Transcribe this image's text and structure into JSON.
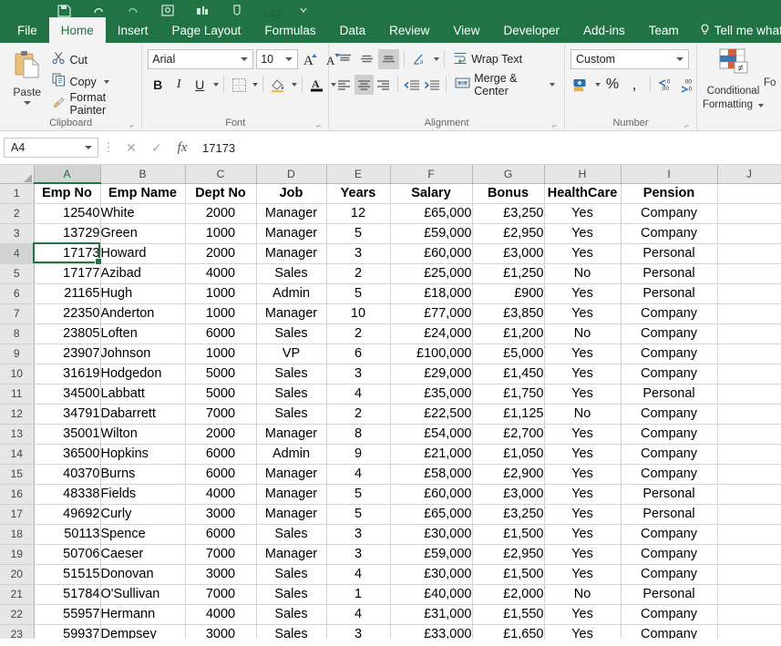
{
  "app": {
    "accent_green": "#217346",
    "ribbon_bg": "#f3f3f3"
  },
  "quick_access": {
    "icons": [
      "save-icon",
      "undo-icon",
      "redo-icon",
      "print-preview-icon",
      "chart-icon",
      "touch-mode-icon",
      "l12-icon",
      "customize-caret-icon"
    ],
    "l12_label": "L12"
  },
  "ribbon_tabs": [
    {
      "label": "File",
      "active": false
    },
    {
      "label": "Home",
      "active": true
    },
    {
      "label": "Insert",
      "active": false
    },
    {
      "label": "Page Layout",
      "active": false
    },
    {
      "label": "Formulas",
      "active": false
    },
    {
      "label": "Data",
      "active": false
    },
    {
      "label": "Review",
      "active": false
    },
    {
      "label": "View",
      "active": false
    },
    {
      "label": "Developer",
      "active": false
    },
    {
      "label": "Add-ins",
      "active": false
    },
    {
      "label": "Team",
      "active": false
    }
  ],
  "tell_me": {
    "label": "Tell me what you",
    "icon": "lightbulb-icon"
  },
  "clipboard": {
    "group_label": "Clipboard",
    "paste_label": "Paste",
    "cut_label": "Cut",
    "copy_label": "Copy",
    "format_painter_label": "Format Painter"
  },
  "font": {
    "group_label": "Font",
    "font_name": "Arial",
    "font_size": "10",
    "bold_label": "B",
    "italic_label": "I",
    "underline_label": "U",
    "grow_label": "A",
    "shrink_label": "A"
  },
  "alignment": {
    "group_label": "Alignment",
    "wrap_text_label": "Wrap Text",
    "merge_center_label": "Merge & Center"
  },
  "number": {
    "group_label": "Number",
    "format": "Custom",
    "percent_label": "%",
    "comma_label": ",",
    "increase_decimal_label": ".00",
    "decrease_decimal_label": ".00"
  },
  "styles": {
    "conditional_formatting_label": "Conditional\nFormatting",
    "conditional_formatting_line1": "Conditional",
    "conditional_formatting_line2": "Formatting",
    "format_as_table_stub_line1": "Fo",
    "format_as_table_stub_line2": ""
  },
  "formula_bar": {
    "name_box": "A4",
    "cancel_icon": "cancel-icon",
    "enter_icon": "check-icon",
    "function_icon": "fx-icon",
    "value": "17173"
  },
  "grid": {
    "column_headers": [
      "A",
      "B",
      "C",
      "D",
      "E",
      "F",
      "G",
      "H",
      "I",
      "J"
    ],
    "selected_column": "A",
    "selected_row": 4,
    "active_cell": "A4",
    "row_numbers": [
      1,
      2,
      3,
      4,
      5,
      6,
      7,
      8,
      9,
      10,
      11,
      12,
      13,
      14,
      15,
      16,
      17,
      18,
      19,
      20,
      21,
      22,
      23
    ],
    "headers": [
      "Emp No",
      "Emp Name",
      "Dept No",
      "Job",
      "Years",
      "Salary",
      "Bonus",
      "HealthCare",
      "Pension",
      ""
    ],
    "rows": [
      [
        "12540",
        "White",
        "2000",
        "Manager",
        "12",
        "£65,000",
        "£3,250",
        "Yes",
        "Company",
        ""
      ],
      [
        "13729",
        "Green",
        "1000",
        "Manager",
        "5",
        "£59,000",
        "£2,950",
        "Yes",
        "Company",
        ""
      ],
      [
        "17173",
        "Howard",
        "2000",
        "Manager",
        "3",
        "£60,000",
        "£3,000",
        "Yes",
        "Personal",
        ""
      ],
      [
        "17177",
        "Azibad",
        "4000",
        "Sales",
        "2",
        "£25,000",
        "£1,250",
        "No",
        "Personal",
        ""
      ],
      [
        "21165",
        "Hugh",
        "1000",
        "Admin",
        "5",
        "£18,000",
        "£900",
        "Yes",
        "Personal",
        ""
      ],
      [
        "22350",
        "Anderton",
        "1000",
        "Manager",
        "10",
        "£77,000",
        "£3,850",
        "Yes",
        "Company",
        ""
      ],
      [
        "23805",
        "Loften",
        "6000",
        "Sales",
        "2",
        "£24,000",
        "£1,200",
        "No",
        "Company",
        ""
      ],
      [
        "23907",
        "Johnson",
        "1000",
        "VP",
        "6",
        "£100,000",
        "£5,000",
        "Yes",
        "Company",
        ""
      ],
      [
        "31619",
        "Hodgedon",
        "5000",
        "Sales",
        "3",
        "£29,000",
        "£1,450",
        "Yes",
        "Company",
        ""
      ],
      [
        "34500",
        "Labbatt",
        "5000",
        "Sales",
        "4",
        "£35,000",
        "£1,750",
        "Yes",
        "Personal",
        ""
      ],
      [
        "34791",
        "Dabarrett",
        "7000",
        "Sales",
        "2",
        "£22,500",
        "£1,125",
        "No",
        "Company",
        ""
      ],
      [
        "35001",
        "Wilton",
        "2000",
        "Manager",
        "8",
        "£54,000",
        "£2,700",
        "Yes",
        "Company",
        ""
      ],
      [
        "36500",
        "Hopkins",
        "6000",
        "Admin",
        "9",
        "£21,000",
        "£1,050",
        "Yes",
        "Company",
        ""
      ],
      [
        "40370",
        "Burns",
        "6000",
        "Manager",
        "4",
        "£58,000",
        "£2,900",
        "Yes",
        "Company",
        ""
      ],
      [
        "48338",
        "Fields",
        "4000",
        "Manager",
        "5",
        "£60,000",
        "£3,000",
        "Yes",
        "Personal",
        ""
      ],
      [
        "49692",
        "Curly",
        "3000",
        "Manager",
        "5",
        "£65,000",
        "£3,250",
        "Yes",
        "Personal",
        ""
      ],
      [
        "50113",
        "Spence",
        "6000",
        "Sales",
        "3",
        "£30,000",
        "£1,500",
        "Yes",
        "Company",
        ""
      ],
      [
        "50706",
        "Caeser",
        "7000",
        "Manager",
        "3",
        "£59,000",
        "£2,950",
        "Yes",
        "Company",
        ""
      ],
      [
        "51515",
        "Donovan",
        "3000",
        "Sales",
        "4",
        "£30,000",
        "£1,500",
        "Yes",
        "Company",
        ""
      ],
      [
        "51784",
        "O'Sullivan",
        "7000",
        "Sales",
        "1",
        "£40,000",
        "£2,000",
        "No",
        "Personal",
        ""
      ],
      [
        "55957",
        "Hermann",
        "4000",
        "Sales",
        "4",
        "£31,000",
        "£1,550",
        "Yes",
        "Company",
        ""
      ],
      [
        "59937",
        "Dempsey",
        "3000",
        "Sales",
        "3",
        "£33,000",
        "£1,650",
        "Yes",
        "Company",
        ""
      ]
    ]
  }
}
